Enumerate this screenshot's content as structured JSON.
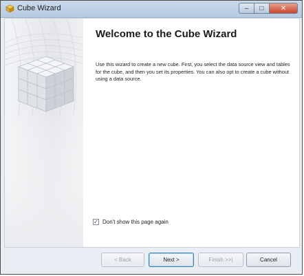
{
  "window": {
    "title": "Cube Wizard"
  },
  "page": {
    "heading": "Welcome to the Cube Wizard",
    "description": "Use this wizard to create a new cube. First, you select the data source view and tables for the cube, and then you set its properties. You can also opt to create a cube without using a data source.",
    "dont_show": {
      "label": "Don't show this page again",
      "checked": true
    }
  },
  "buttons": {
    "back": "< Back",
    "next": "Next >",
    "finish": "Finish >>|",
    "cancel": "Cancel"
  },
  "icons": {
    "title_icon": "cube-wizard-icon",
    "check_glyph": "✓",
    "close_glyph": "✕",
    "minimize_glyph": "–",
    "maximize_glyph": "□"
  },
  "colors": {
    "titlebar": "#b6cbe1",
    "close_button": "#c8452c",
    "default_button_border": "#3c7fb1"
  }
}
